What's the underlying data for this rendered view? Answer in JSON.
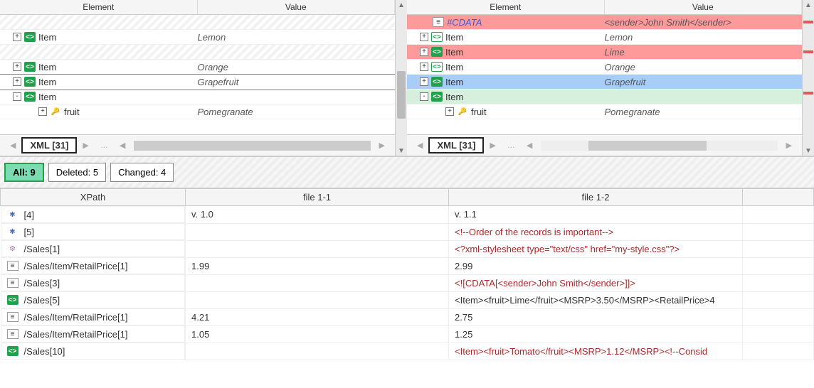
{
  "tree_headers": {
    "element": "Element",
    "value": "Value"
  },
  "left": {
    "rows": [
      {
        "type": "blank"
      },
      {
        "twisty": "+",
        "icon": "tag",
        "label": "Item",
        "value": "Lemon",
        "indent": 1
      },
      {
        "type": "blank"
      },
      {
        "twisty": "+",
        "icon": "tag",
        "label": "Item",
        "value": "Orange",
        "indent": 1
      },
      {
        "twisty": "+",
        "icon": "tag",
        "label": "Item",
        "value": "Grapefruit",
        "indent": 1,
        "sel": true
      },
      {
        "twisty": "-",
        "icon": "tag",
        "label": "Item",
        "value": "",
        "indent": 1
      },
      {
        "twisty": "+",
        "icon": "key",
        "label": "fruit",
        "value": "Pomegranate",
        "indent": 3
      }
    ],
    "tab": "XML [31]"
  },
  "right": {
    "rows": [
      {
        "icon": "doc",
        "label": "#CDATA",
        "value": "<sender>John Smith</sender>",
        "indent": 2,
        "cls": "diff-red",
        "cdata": true
      },
      {
        "twisty": "+",
        "icon": "tag-green-outline",
        "label": "Item",
        "value": "Lemon",
        "indent": 1
      },
      {
        "twisty": "+",
        "icon": "tag",
        "label": "Item",
        "value": "Lime",
        "indent": 1,
        "cls": "diff-red"
      },
      {
        "twisty": "+",
        "icon": "tag-green-outline",
        "label": "Item",
        "value": "Orange",
        "indent": 1
      },
      {
        "twisty": "+",
        "icon": "tag",
        "label": "Item",
        "value": "Grapefruit",
        "indent": 1,
        "cls": "diff-blue"
      },
      {
        "twisty": "-",
        "icon": "tag",
        "label": "Item",
        "value": "",
        "indent": 1,
        "cls": "diff-green"
      },
      {
        "twisty": "+",
        "icon": "key",
        "label": "fruit",
        "value": "Pomegranate",
        "indent": 3
      }
    ],
    "tab": "XML [31]"
  },
  "filters": {
    "all": "All: 9",
    "deleted": "Deleted: 5",
    "changed": "Changed: 4"
  },
  "diff_headers": {
    "xpath": "XPath",
    "file1": "file 1-1",
    "file2": "file 1-2"
  },
  "diff_rows": [
    {
      "icon": "attr",
      "xpath": "[4]",
      "f1": "v. 1.0",
      "f2": "v. 1.1",
      "f2_red": false
    },
    {
      "icon": "attr",
      "xpath": "[5]",
      "f1": "",
      "f2": "<!--Order of the records is important-->",
      "f2_red": true
    },
    {
      "icon": "gear",
      "xpath": "/Sales[1]",
      "f1": "",
      "f2": "<?xml-stylesheet type=\"text/css\" href=\"my-style.css\"?>",
      "f2_red": true
    },
    {
      "icon": "doc",
      "xpath": "/Sales/Item/RetailPrice[1]",
      "f1": "1.99",
      "f2": "2.99",
      "f2_red": false
    },
    {
      "icon": "doc",
      "xpath": "/Sales[3]",
      "f1": "",
      "f2": "<![CDATA[<sender>John Smith</sender>]]>",
      "f2_red": true
    },
    {
      "icon": "tag",
      "xpath": "/Sales[5]",
      "f1": "",
      "f2": "<Item><fruit>Lime</fruit><MSRP>3.50</MSRP><RetailPrice>4",
      "f2_red": false
    },
    {
      "icon": "doc",
      "xpath": "/Sales/Item/RetailPrice[1]",
      "f1": "4.21",
      "f2": "2.75",
      "f2_red": false
    },
    {
      "icon": "doc",
      "xpath": "/Sales/Item/RetailPrice[1]",
      "f1": "1.05",
      "f2": "1.25",
      "f2_red": false
    },
    {
      "icon": "tag",
      "xpath": "/Sales[10]",
      "f1": "",
      "f2": "<Item><fruit>Tomato</fruit><MSRP>1.12</MSRP><!--Consid",
      "f2_red": true
    }
  ]
}
